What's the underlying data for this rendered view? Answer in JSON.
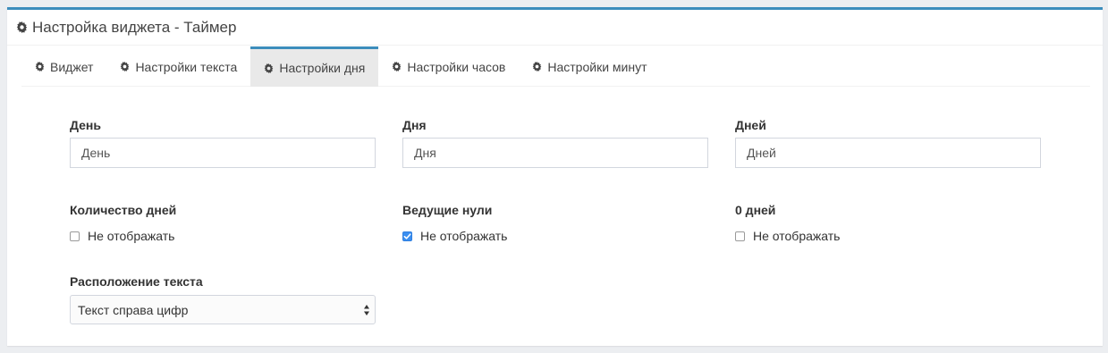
{
  "panel": {
    "title": "Настройка виджета - Таймер"
  },
  "tabs": [
    {
      "label": "Виджет",
      "active": false
    },
    {
      "label": "Настройки текста",
      "active": false
    },
    {
      "label": "Настройки дня",
      "active": true
    },
    {
      "label": "Настройки часов",
      "active": false
    },
    {
      "label": "Настройки минут",
      "active": false
    }
  ],
  "fields": {
    "day": {
      "label": "День",
      "value": "День"
    },
    "day_few": {
      "label": "Дня",
      "value": "Дня"
    },
    "day_many": {
      "label": "Дней",
      "value": "Дней"
    }
  },
  "checks": {
    "days_count": {
      "label": "Количество дней",
      "option": "Не отображать",
      "checked": false
    },
    "leading_zeros": {
      "label": "Ведущие нули",
      "option": "Не отображать",
      "checked": true
    },
    "zero_days": {
      "label": "0 дней",
      "option": "Не отображать",
      "checked": false
    }
  },
  "text_position": {
    "label": "Расположение текста",
    "selected": "Текст справа цифр"
  },
  "colors": {
    "accent": "#3c8dbc",
    "checkbox_checked": "#3b8ff0",
    "active_tab_bg": "#e9e9e9"
  }
}
